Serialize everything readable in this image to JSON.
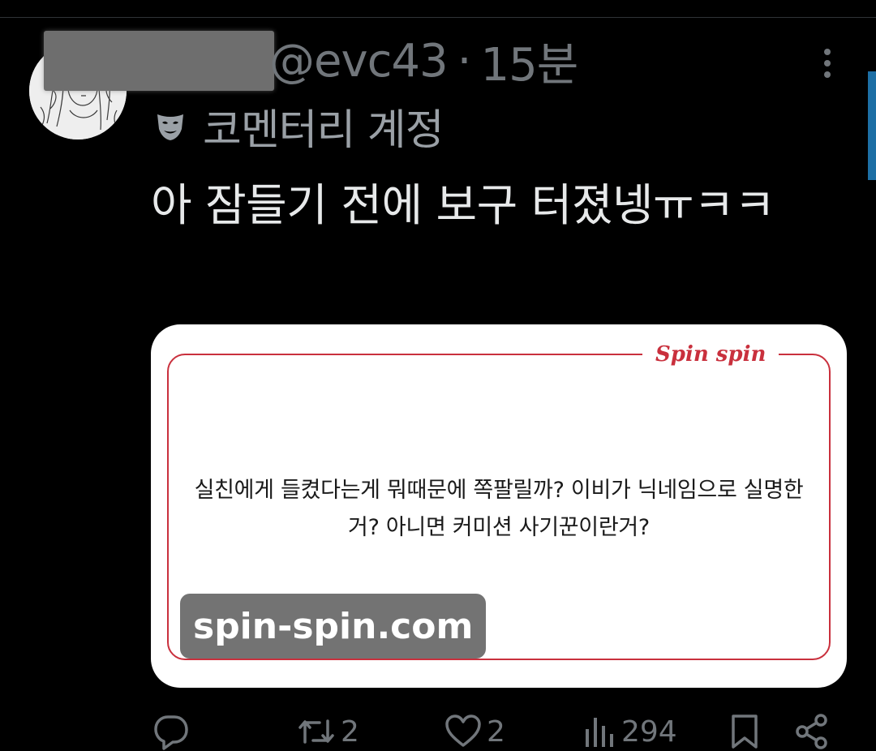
{
  "tweet": {
    "handle": "@evc43",
    "separator": "·",
    "time": "15분",
    "account_label": "코멘터리 계정",
    "text": "아 잠들기 전에 보구 터졌넹ㅠㅋㅋ"
  },
  "card": {
    "brand": "Spin spin",
    "question": "실친에게 들켰다는게 뭐때문에 쪽팔릴까? 이비가 닉네임으로 실명한거? 아니면 커미션 사기꾼이란거?",
    "domain": "spin-spin.com"
  },
  "actions": {
    "reply_count": "",
    "retweet_count": "2",
    "like_count": "2",
    "view_count": "294"
  },
  "icons": {
    "more": "more-vertical-icon",
    "account": "mask-icon",
    "reply": "reply-icon",
    "retweet": "retweet-icon",
    "like": "heart-icon",
    "views": "views-icon",
    "bookmark": "bookmark-icon",
    "share": "share-icon"
  },
  "colors": {
    "background": "#000000",
    "text_primary": "#e7e9ea",
    "text_secondary": "#71767b",
    "brand_red": "#c9303d",
    "accent_blue": "#1d6fa5"
  }
}
